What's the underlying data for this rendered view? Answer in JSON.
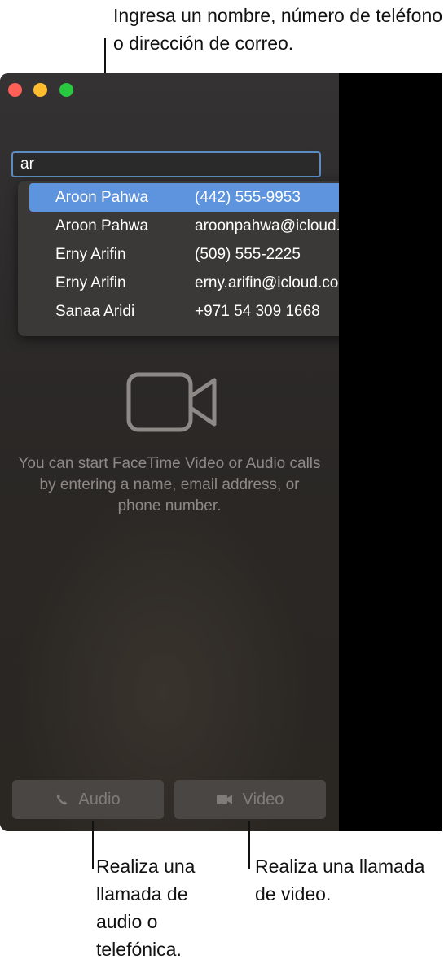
{
  "annotations": {
    "top": "Ingresa un nombre, número de teléfono o dirección de correo.",
    "audio": "Realiza una llamada de audio o telefónica.",
    "video": "Realiza una llamada de video."
  },
  "window": {
    "controls": [
      "close",
      "minimize",
      "zoom"
    ],
    "search": {
      "value": "ar"
    },
    "suggestions": [
      {
        "name": "Aroon Pahwa",
        "value": "(442) 555-9953",
        "selected": true
      },
      {
        "name": "Aroon Pahwa",
        "value": "aroonpahwa@icloud.com",
        "selected": false
      },
      {
        "name": "Erny Arifin",
        "value": "(509) 555-2225",
        "selected": false
      },
      {
        "name": "Erny Arifin",
        "value": "erny.arifin@icloud.com",
        "selected": false
      },
      {
        "name": "Sanaa Aridi",
        "value": "+971 54 309 1668",
        "selected": false
      }
    ],
    "empty_state": {
      "icon": "video-camera-icon",
      "message": "You can start FaceTime Video or Audio calls by entering a name, email address, or phone number."
    },
    "buttons": {
      "audio_label": "Audio",
      "audio_icon": "phone-icon",
      "video_label": "Video",
      "video_icon": "video-camera-icon"
    }
  },
  "colors": {
    "selection": "#5e93dd",
    "close": "#fe5f57",
    "minimize": "#febc2e",
    "zoom": "#28c840",
    "focus_ring": "#5b8cc4"
  }
}
